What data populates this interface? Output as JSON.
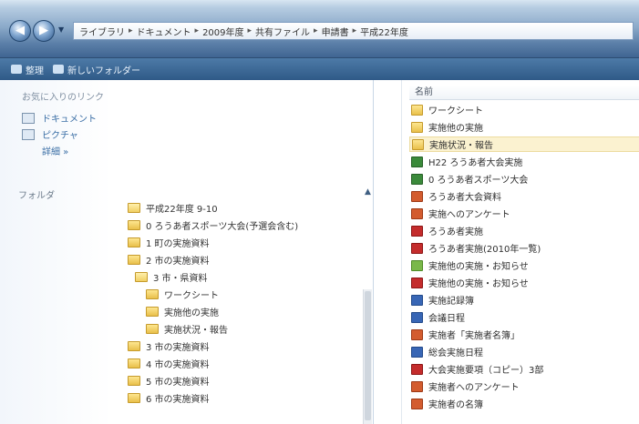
{
  "address_bar": {
    "breadcrumbs": [
      "ライブラリ",
      "ドキュメント",
      "2009年度",
      "共有ファイル",
      "申請書",
      "平成22年度"
    ]
  },
  "toolbar": {
    "items": [
      "整理",
      "新しいフォルダー"
    ]
  },
  "favorites": {
    "header": "お気に入りのリンク",
    "items": [
      {
        "label": "ドキュメント",
        "icon": "documents-icon"
      },
      {
        "label": "ピクチャ",
        "icon": "pictures-icon"
      },
      {
        "label": "詳細 »",
        "icon": ""
      }
    ]
  },
  "folders": {
    "header": "フォルダ",
    "tree": [
      {
        "label": "平成22年度 9-10",
        "open": true
      },
      {
        "label": "0 ろうあ者スポーツ大会(予選会含む)",
        "open": false
      },
      {
        "label": "1 町の実施資料",
        "open": false
      },
      {
        "label": "2 市の実施資料",
        "open": false
      },
      {
        "label": "3 市・県資料",
        "open": true
      },
      {
        "label": "ワークシート",
        "open": false
      },
      {
        "label": "実施他の実施",
        "open": false
      },
      {
        "label": "実施状況・報告",
        "open": false
      },
      {
        "label": "3 市の実施資料",
        "open": false
      },
      {
        "label": "4 市の実施資料",
        "open": false
      },
      {
        "label": "5 市の実施資料",
        "open": false
      },
      {
        "label": "6 市の実施資料",
        "open": false
      }
    ]
  },
  "files": {
    "header": "名前",
    "rows": [
      {
        "label": "ワークシート",
        "icon": "folder"
      },
      {
        "label": "実施他の実施",
        "icon": "folder"
      },
      {
        "label": "実施状況・報告",
        "icon": "folder",
        "selected": true
      },
      {
        "label": "H22 ろうあ者大会実施",
        "icon": "excel"
      },
      {
        "label": "0 ろうあ者スポーツ大会",
        "icon": "excel"
      },
      {
        "label": "ろうあ者大会資料",
        "icon": "ppt"
      },
      {
        "label": "実施へのアンケート",
        "icon": "ppt"
      },
      {
        "label": "ろうあ者実施",
        "icon": "pdf"
      },
      {
        "label": "ろうあ者実施(2010年一覧)",
        "icon": "pdf"
      },
      {
        "label": "実施他の実施・お知らせ",
        "icon": "img"
      },
      {
        "label": "実施他の実施・お知らせ",
        "icon": "pdf"
      },
      {
        "label": "実施記録簿",
        "icon": "word"
      },
      {
        "label": "会議日程",
        "icon": "word"
      },
      {
        "label": "実施者「実施者名簿」",
        "icon": "ppt"
      },
      {
        "label": "総会実施日程",
        "icon": "word"
      },
      {
        "label": "大会実施要項（コピー）3部",
        "icon": "pdf"
      },
      {
        "label": "実施者へのアンケート",
        "icon": "ppt"
      },
      {
        "label": "実施者の名簿",
        "icon": "ppt"
      }
    ]
  }
}
